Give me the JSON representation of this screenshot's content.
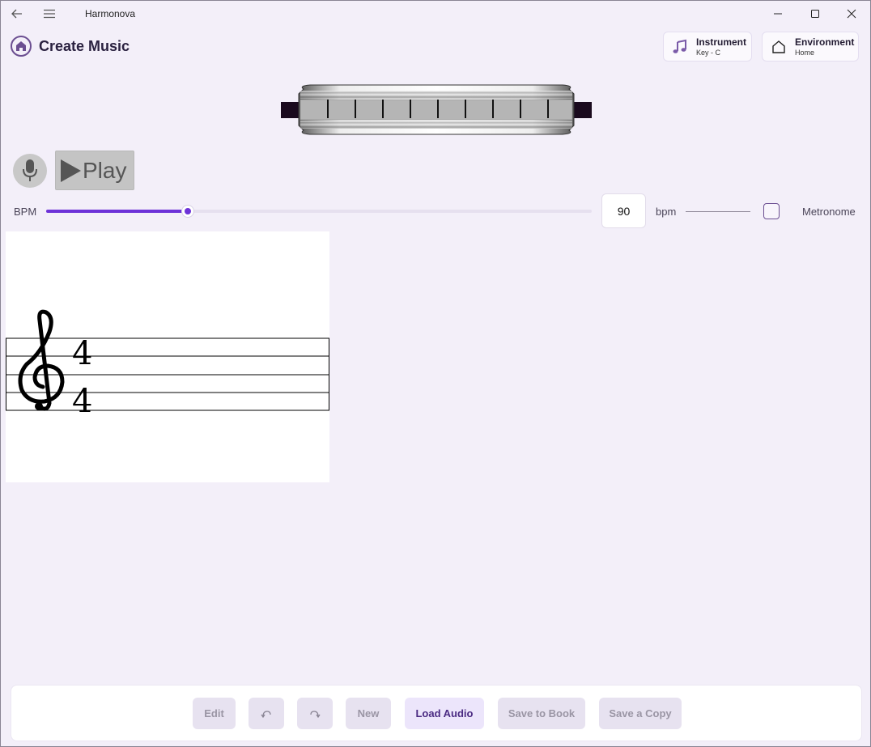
{
  "window": {
    "title": "Harmonova"
  },
  "header": {
    "page_title": "Create Music"
  },
  "instrument": {
    "title": "Instrument",
    "subtitle": "Key - C"
  },
  "environment": {
    "title": "Environment",
    "subtitle": "Home"
  },
  "controls": {
    "play_label": "Play",
    "bpm_label": "BPM",
    "bpm_value": "90",
    "bpm_unit": "bpm",
    "bpm_slider_fraction": 0.26,
    "metronome_label": "Metronome",
    "metronome_checked": false
  },
  "score": {
    "clef": "treble",
    "time_signature": {
      "top": "4",
      "bottom": "4"
    }
  },
  "toolbar": {
    "edit": "Edit",
    "undo_icon": "undo-icon",
    "redo_icon": "redo-icon",
    "new": "New",
    "load_audio": "Load Audio",
    "save_to_book": "Save to Book",
    "save_copy": "Save a Copy"
  },
  "colors": {
    "accent": "#6d32d8",
    "background": "#f3eff9",
    "brand": "#6b4e91"
  }
}
